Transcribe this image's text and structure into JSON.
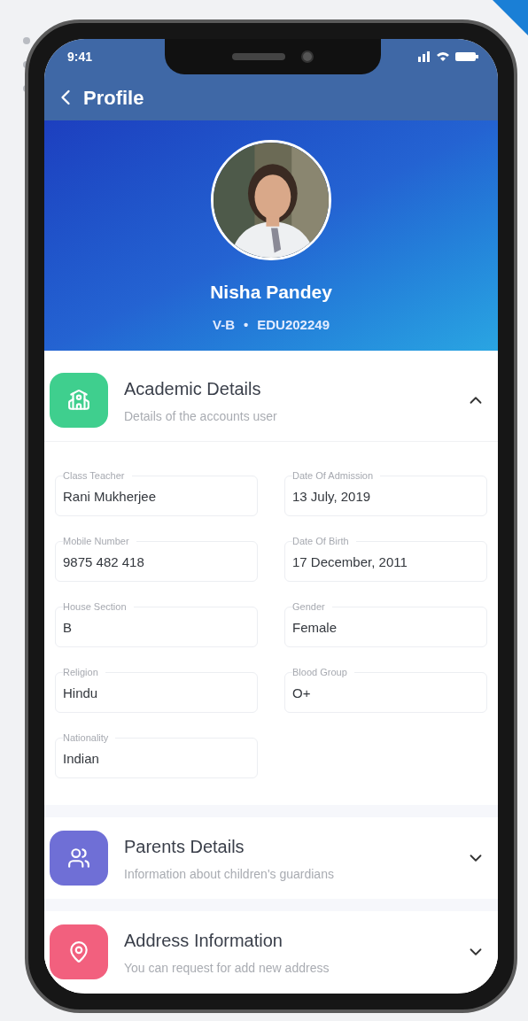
{
  "status_bar": {
    "time": "9:41"
  },
  "header": {
    "title": "Profile"
  },
  "profile": {
    "name": "Nisha Pandey",
    "class": "V-B",
    "separator": "•",
    "id": "EDU202249"
  },
  "sections": [
    {
      "title": "Academic Details",
      "subtitle": "Details of the accounts user",
      "expanded": true,
      "color": "#3fcf8e",
      "fields": [
        {
          "label": "Class Teacher",
          "value": "Rani Mukherjee"
        },
        {
          "label": "Date Of Admission",
          "value": "13 July, 2019"
        },
        {
          "label": "Mobile Number",
          "value": "9875 482 418"
        },
        {
          "label": "Date Of Birth",
          "value": "17 December, 2011"
        },
        {
          "label": "House Section",
          "value": "B"
        },
        {
          "label": "Gender",
          "value": "Female"
        },
        {
          "label": "Religion",
          "value": "Hindu"
        },
        {
          "label": "Blood Group",
          "value": "O+"
        },
        {
          "label": "Nationality",
          "value": "Indian"
        }
      ]
    },
    {
      "title": "Parents Details",
      "subtitle": "Information about children's guardians",
      "expanded": false,
      "color": "#6f6fd6"
    },
    {
      "title": "Address Information",
      "subtitle": "You can request for add new address",
      "expanded": false,
      "color": "#f2607e"
    }
  ]
}
